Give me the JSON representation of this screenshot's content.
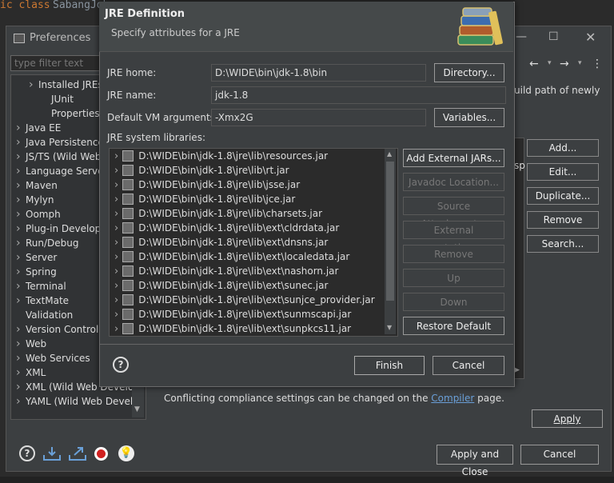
{
  "editor": {
    "code_keyword": "ic class",
    "code_classname": "SabangJob"
  },
  "preferences": {
    "title": "Preferences",
    "filter_placeholder": "type filter text",
    "tree_items": [
      {
        "label": "Installed JREs",
        "indent": 1,
        "arrow": true
      },
      {
        "label": "JUnit",
        "indent": 2,
        "arrow": false
      },
      {
        "label": "Properties File",
        "indent": 2,
        "arrow": false
      },
      {
        "label": "Java EE",
        "indent": 0,
        "arrow": true
      },
      {
        "label": "Java Persistence",
        "indent": 0,
        "arrow": true
      },
      {
        "label": "JS/TS (Wild Web",
        "indent": 0,
        "arrow": true
      },
      {
        "label": "Language Server",
        "indent": 0,
        "arrow": true
      },
      {
        "label": "Maven",
        "indent": 0,
        "arrow": true
      },
      {
        "label": "Mylyn",
        "indent": 0,
        "arrow": true
      },
      {
        "label": "Oomph",
        "indent": 0,
        "arrow": true
      },
      {
        "label": "Plug-in Develop",
        "indent": 0,
        "arrow": true
      },
      {
        "label": "Run/Debug",
        "indent": 0,
        "arrow": true
      },
      {
        "label": "Server",
        "indent": 0,
        "arrow": true
      },
      {
        "label": "Spring",
        "indent": 0,
        "arrow": true
      },
      {
        "label": "Terminal",
        "indent": 0,
        "arrow": true
      },
      {
        "label": "TextMate",
        "indent": 0,
        "arrow": true
      },
      {
        "label": "Validation",
        "indent": 0,
        "arrow": false
      },
      {
        "label": "Version Control",
        "indent": 0,
        "arrow": true
      },
      {
        "label": "Web",
        "indent": 0,
        "arrow": true
      },
      {
        "label": "Web Services",
        "indent": 0,
        "arrow": true
      },
      {
        "label": "XML",
        "indent": 0,
        "arrow": true
      },
      {
        "label": "XML (Wild Web Develo",
        "indent": 0,
        "arrow": true
      },
      {
        "label": "YAML (Wild Web Develo",
        "indent": 0,
        "arrow": true
      }
    ],
    "hint_text": "uild path of newly",
    "side_buttons": [
      "Add...",
      "Edit...",
      "Duplicate...",
      "Remove",
      "Search..."
    ],
    "compliance_text": "Conflicting compliance settings can be changed on the ",
    "compliance_link": "Compiler",
    "compliance_suffix": " page.",
    "apply_label": "Apply",
    "apply_close_label": "Apply and Close",
    "cancel_label": "Cancel"
  },
  "dialog": {
    "title": "JRE Definition",
    "subtitle": "Specify attributes for a JRE",
    "jre_home_label": "JRE home:",
    "jre_home_value": "D:\\WIDE\\bin\\jdk-1.8\\bin",
    "directory_button": "Directory...",
    "jre_name_label": "JRE name:",
    "jre_name_value": "jdk-1.8",
    "vm_args_label": "Default VM arguments:",
    "vm_args_value": "-Xmx2G",
    "variables_button": "Variables...",
    "libraries_label": "JRE system libraries:",
    "libraries": [
      "D:\\WIDE\\bin\\jdk-1.8\\jre\\lib\\resources.jar",
      "D:\\WIDE\\bin\\jdk-1.8\\jre\\lib\\rt.jar",
      "D:\\WIDE\\bin\\jdk-1.8\\jre\\lib\\jsse.jar",
      "D:\\WIDE\\bin\\jdk-1.8\\jre\\lib\\jce.jar",
      "D:\\WIDE\\bin\\jdk-1.8\\jre\\lib\\charsets.jar",
      "D:\\WIDE\\bin\\jdk-1.8\\jre\\lib\\ext\\cldrdata.jar",
      "D:\\WIDE\\bin\\jdk-1.8\\jre\\lib\\ext\\dnsns.jar",
      "D:\\WIDE\\bin\\jdk-1.8\\jre\\lib\\ext\\localedata.jar",
      "D:\\WIDE\\bin\\jdk-1.8\\jre\\lib\\ext\\nashorn.jar",
      "D:\\WIDE\\bin\\jdk-1.8\\jre\\lib\\ext\\sunec.jar",
      "D:\\WIDE\\bin\\jdk-1.8\\jre\\lib\\ext\\sunjce_provider.jar",
      "D:\\WIDE\\bin\\jdk-1.8\\jre\\lib\\ext\\sunmscapi.jar",
      "D:\\WIDE\\bin\\jdk-1.8\\jre\\lib\\ext\\sunpkcs11.jar"
    ],
    "lib_buttons": [
      {
        "label": "Add External JARs...",
        "enabled": true
      },
      {
        "label": "Javadoc Location...",
        "enabled": false
      },
      {
        "label": "Source Attachment...",
        "enabled": false
      },
      {
        "label": "External annotations...",
        "enabled": false
      },
      {
        "label": "Remove",
        "enabled": false
      },
      {
        "label": "Up",
        "enabled": false
      },
      {
        "label": "Down",
        "enabled": false
      },
      {
        "label": "Restore Default",
        "enabled": true
      }
    ],
    "finish_button": "Finish",
    "cancel_button": "Cancel"
  },
  "colors": {
    "accent_link": "#6a9fd8",
    "dialog_bg": "#3c3f41",
    "editor_bg": "#2b2b2b"
  }
}
